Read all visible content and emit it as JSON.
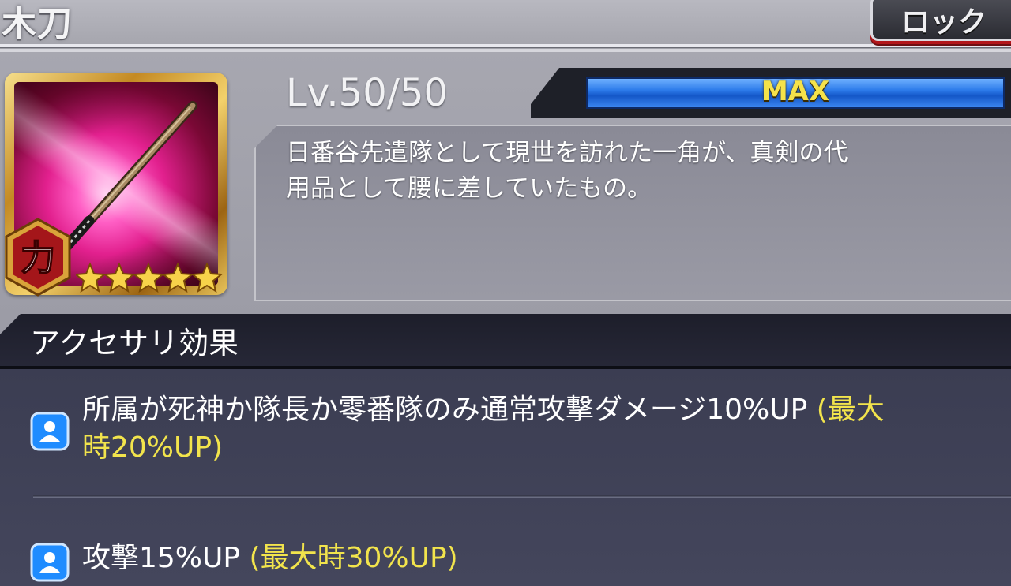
{
  "header": {
    "title": "木刀",
    "lock_button": "ロック"
  },
  "item": {
    "icon": "wooden-sword-icon",
    "badge": "力",
    "stars": 5,
    "level": "Lv.50/50",
    "level_status": "MAX",
    "description_line1": "日番谷先遣隊として現世を訪れた一角が、真剣の代",
    "description_line2": "用品として腰に差していたもの。"
  },
  "effects_section": {
    "title": "アクセサリ効果",
    "effects": [
      {
        "icon": "person-icon",
        "text_line1": "所属が死神か隊長か零番隊のみ通常攻撃ダメージ10%UP ",
        "highlight_line1": "(最大",
        "highlight_line2": "時20%UP)"
      },
      {
        "icon": "person-icon",
        "text": "攻撃15%UP ",
        "highlight": "(最大時30%UP)"
      }
    ]
  },
  "colors": {
    "highlight": "#f2e44c",
    "max_bar": "#2c7bea",
    "lock_accent": "#b2161b"
  }
}
